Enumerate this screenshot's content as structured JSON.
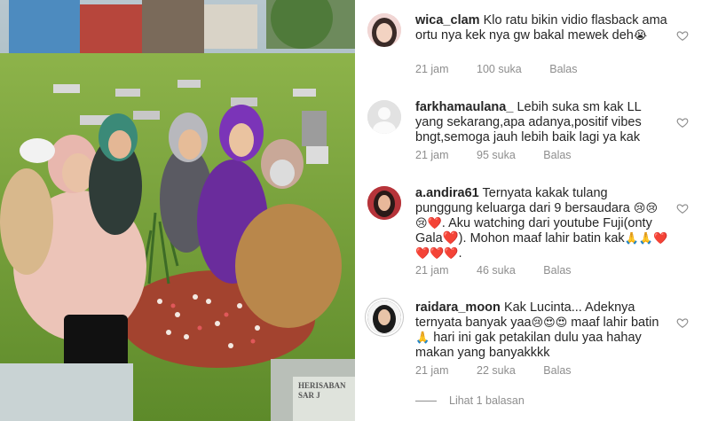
{
  "photo": {
    "gravestone_text": "HERISABAN SAR J"
  },
  "comments": [
    {
      "username": "wica_clam",
      "text": "Klo ratu bikin vidio flasback ama ortu nya kek nya gw bakal mewek deh",
      "emoji": "😭",
      "time": "21 jam",
      "likes": "100 suka",
      "reply": "Balas"
    },
    {
      "username": "farkhamaulana_",
      "text": "Lebih suka sm kak LL yang sekarang,apa adanya,positif vibes bngt,semoga jauh lebih baik lagi ya kak",
      "emoji": "",
      "time": "21 jam",
      "likes": "95 suka",
      "reply": "Balas"
    },
    {
      "username": "a.andira61",
      "text": "Ternyata kakak tulang punggung keluarga dari 9 bersaudara",
      "emoji_line1": "😢😢😢❤️.",
      "text2": "Aku watching dari youtube Fuji(onty Gala❤️). Mohon maaf lahir batin kak",
      "emoji_line2": "🙏🙏❤️❤️❤️❤️.",
      "time": "21 jam",
      "likes": "46 suka",
      "reply": "Balas"
    },
    {
      "username": "raidara_moon",
      "text": "Kak Lucinta... Adeknya ternyata banyak yaa",
      "emoji_a": "😢😍😍",
      "text2": "maaf lahir batin",
      "emoji_b": "🙏",
      "text3": "hari ini gak petakilan dulu yaa hahay makan yang banyakkkk",
      "time": "21 jam",
      "likes": "22 suka",
      "reply": "Balas"
    }
  ],
  "view_replies": "Lihat 1 balasan",
  "colors": {
    "text": "#262626",
    "meta": "#8e8e8e",
    "heart": "#8e8e8e"
  }
}
